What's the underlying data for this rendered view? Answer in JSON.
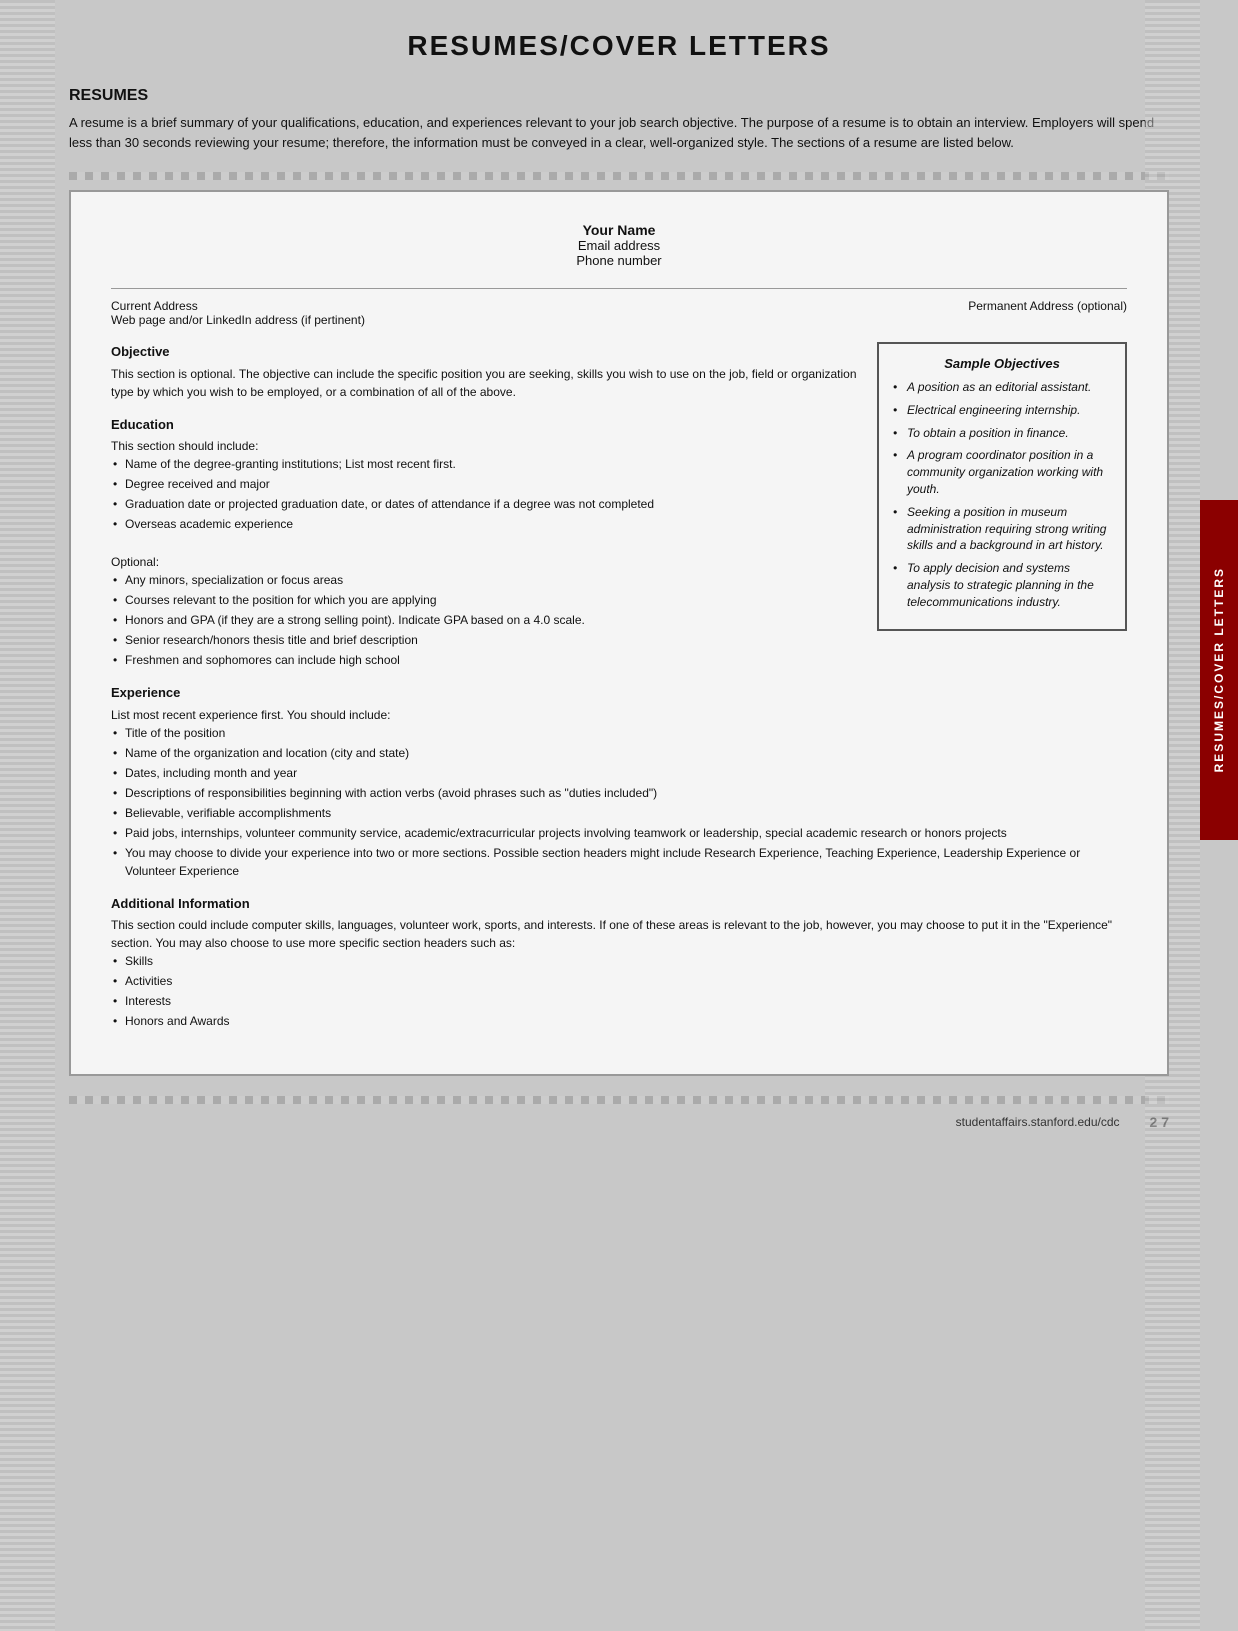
{
  "page": {
    "title": "RESUMES/COVER LETTERS",
    "side_tab": "RESUMES/COVER LETTERS",
    "footer": {
      "url": "studentaffairs.stanford.edu/cdc",
      "page": "2 7"
    }
  },
  "resumes_section": {
    "heading": "RESUMES",
    "intro": "A resume is a brief summary of your qualifications, education, and experiences relevant to your job search objective. The purpose of a resume is to obtain an interview. Employers will spend less than 30 seconds reviewing your resume; therefore, the information must be conveyed in a clear, well-organized style. The sections of a resume are listed below."
  },
  "resume_template": {
    "name": "Your Name",
    "email": "Email address",
    "phone": "Phone number",
    "current_address": "Current Address",
    "web_address": "Web page and/or LinkedIn address (if pertinent)",
    "permanent_address": "Permanent Address (optional)",
    "sections": {
      "objective": {
        "title": "Objective",
        "body": "This section is optional. The objective can include the specific position you are seeking, skills you wish to use on the job, field or organization type by which you wish to be employed, or a combination of all of the above."
      },
      "education": {
        "title": "Education",
        "intro": "This section should include:",
        "bullets": [
          "Name of the degree-granting institutions; List most recent first.",
          "Degree received and major",
          "Graduation date or projected graduation date, or dates of attendance if a degree was not completed",
          "Overseas academic experience"
        ],
        "optional_label": "Optional:",
        "optional_bullets": [
          "Any minors, specialization or focus areas",
          "Courses relevant to the position for which you are applying",
          "Honors and GPA (if they are a strong selling point). Indicate GPA based on a 4.0 scale.",
          "Senior research/honors thesis title and brief description",
          "Freshmen and sophomores can include high school"
        ]
      },
      "experience": {
        "title": "Experience",
        "intro": "List most recent experience first. You should include:",
        "bullets": [
          "Title of the position",
          "Name of the organization and location (city and state)",
          "Dates, including month and year",
          "Descriptions of responsibilities beginning with action verbs (avoid phrases such as \"duties included\")",
          "Believable, verifiable accomplishments",
          "Paid jobs, internships, volunteer community service, academic/extracurricular projects involving teamwork or leadership, special academic research or honors projects",
          "You may choose to divide your experience into two or more sections. Possible section headers might include Research Experience, Teaching Experience, Leadership Experience or Volunteer Experience"
        ]
      },
      "additional_information": {
        "title": "Additional Information",
        "body": "This section could include computer skills, languages, volunteer work, sports, and interests. If one of these areas is relevant to the job, however, you may choose to put it in the \"Experience\" section. You may also choose to use more specific section headers such as:",
        "bullets": [
          "Skills",
          "Activities",
          "Interests",
          "Honors and Awards"
        ]
      }
    }
  },
  "sample_objectives": {
    "title": "Sample Objectives",
    "items": [
      "A position as an editorial assistant.",
      "Electrical engineering internship.",
      "To obtain a position in finance.",
      "A program coordinator position in a community organization working with youth.",
      "Seeking a position in museum administration requiring strong writing skills and a background in art history.",
      "To apply decision and systems analysis to strategic planning in the telecommunications industry."
    ]
  }
}
